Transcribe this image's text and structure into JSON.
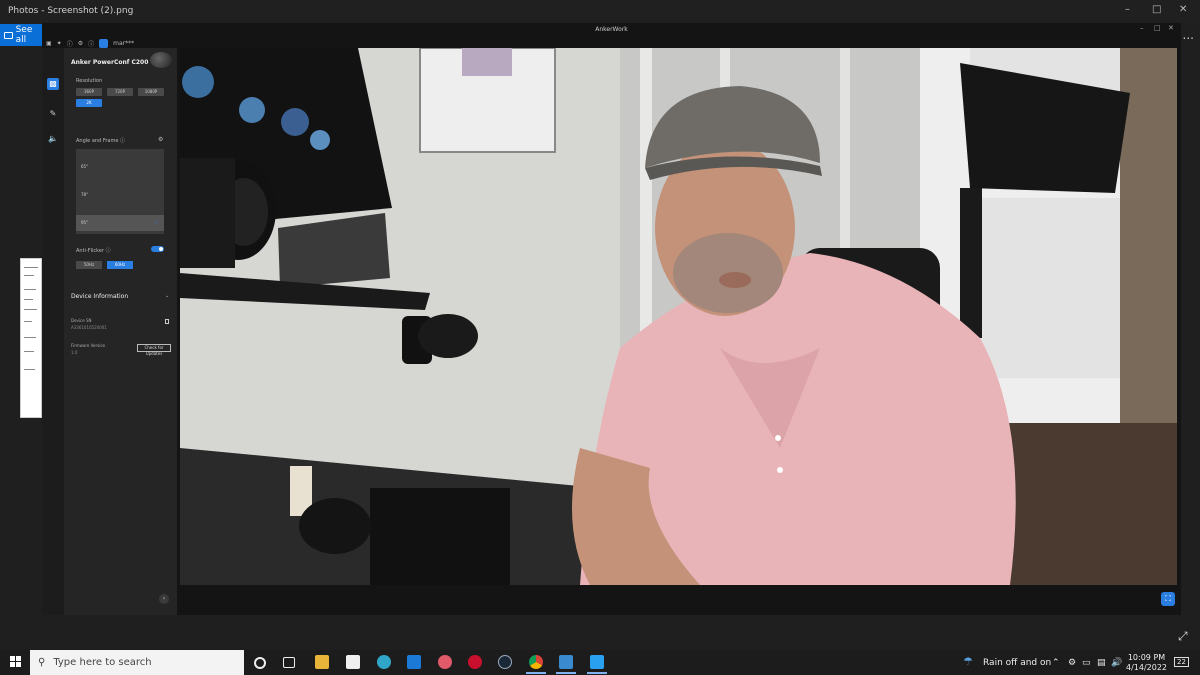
{
  "photos": {
    "title": "Photos - Screenshot (2).png",
    "see_all": "See all",
    "more": "..."
  },
  "anker": {
    "title": "AnkerWork",
    "user": "mar***",
    "device_name": "Anker PowerConf C200",
    "resolution_label": "Resolution",
    "resolutions": [
      "360P",
      "720P",
      "1080P",
      "2K"
    ],
    "selected_resolution": "2K",
    "angle_label": "Angle and Frame",
    "angles": [
      "65°",
      "78°",
      "95°"
    ],
    "selected_angle": "95°",
    "anti_flicker_label": "Anti-Flicker",
    "anti_flicker_on": true,
    "hz_options": [
      "50Hz",
      "60Hz"
    ],
    "selected_hz": "60Hz",
    "device_info_label": "Device Information",
    "device_sn_label": "Device SN",
    "device_sn_value": "A3361010520001",
    "firmware_label": "Firmware Version",
    "firmware_value": "1.0",
    "check_updates": "Check for Updates"
  },
  "taskbar": {
    "search_placeholder": "Type here to search",
    "weather": "Rain off and on",
    "time": "10:09 PM",
    "date": "4/14/2022",
    "notifications": "22"
  },
  "colors": {
    "accent": "#2a7de1",
    "shirt": "#e9b4b8",
    "wall": "#d9d9d6",
    "door": "#eeeeee"
  }
}
